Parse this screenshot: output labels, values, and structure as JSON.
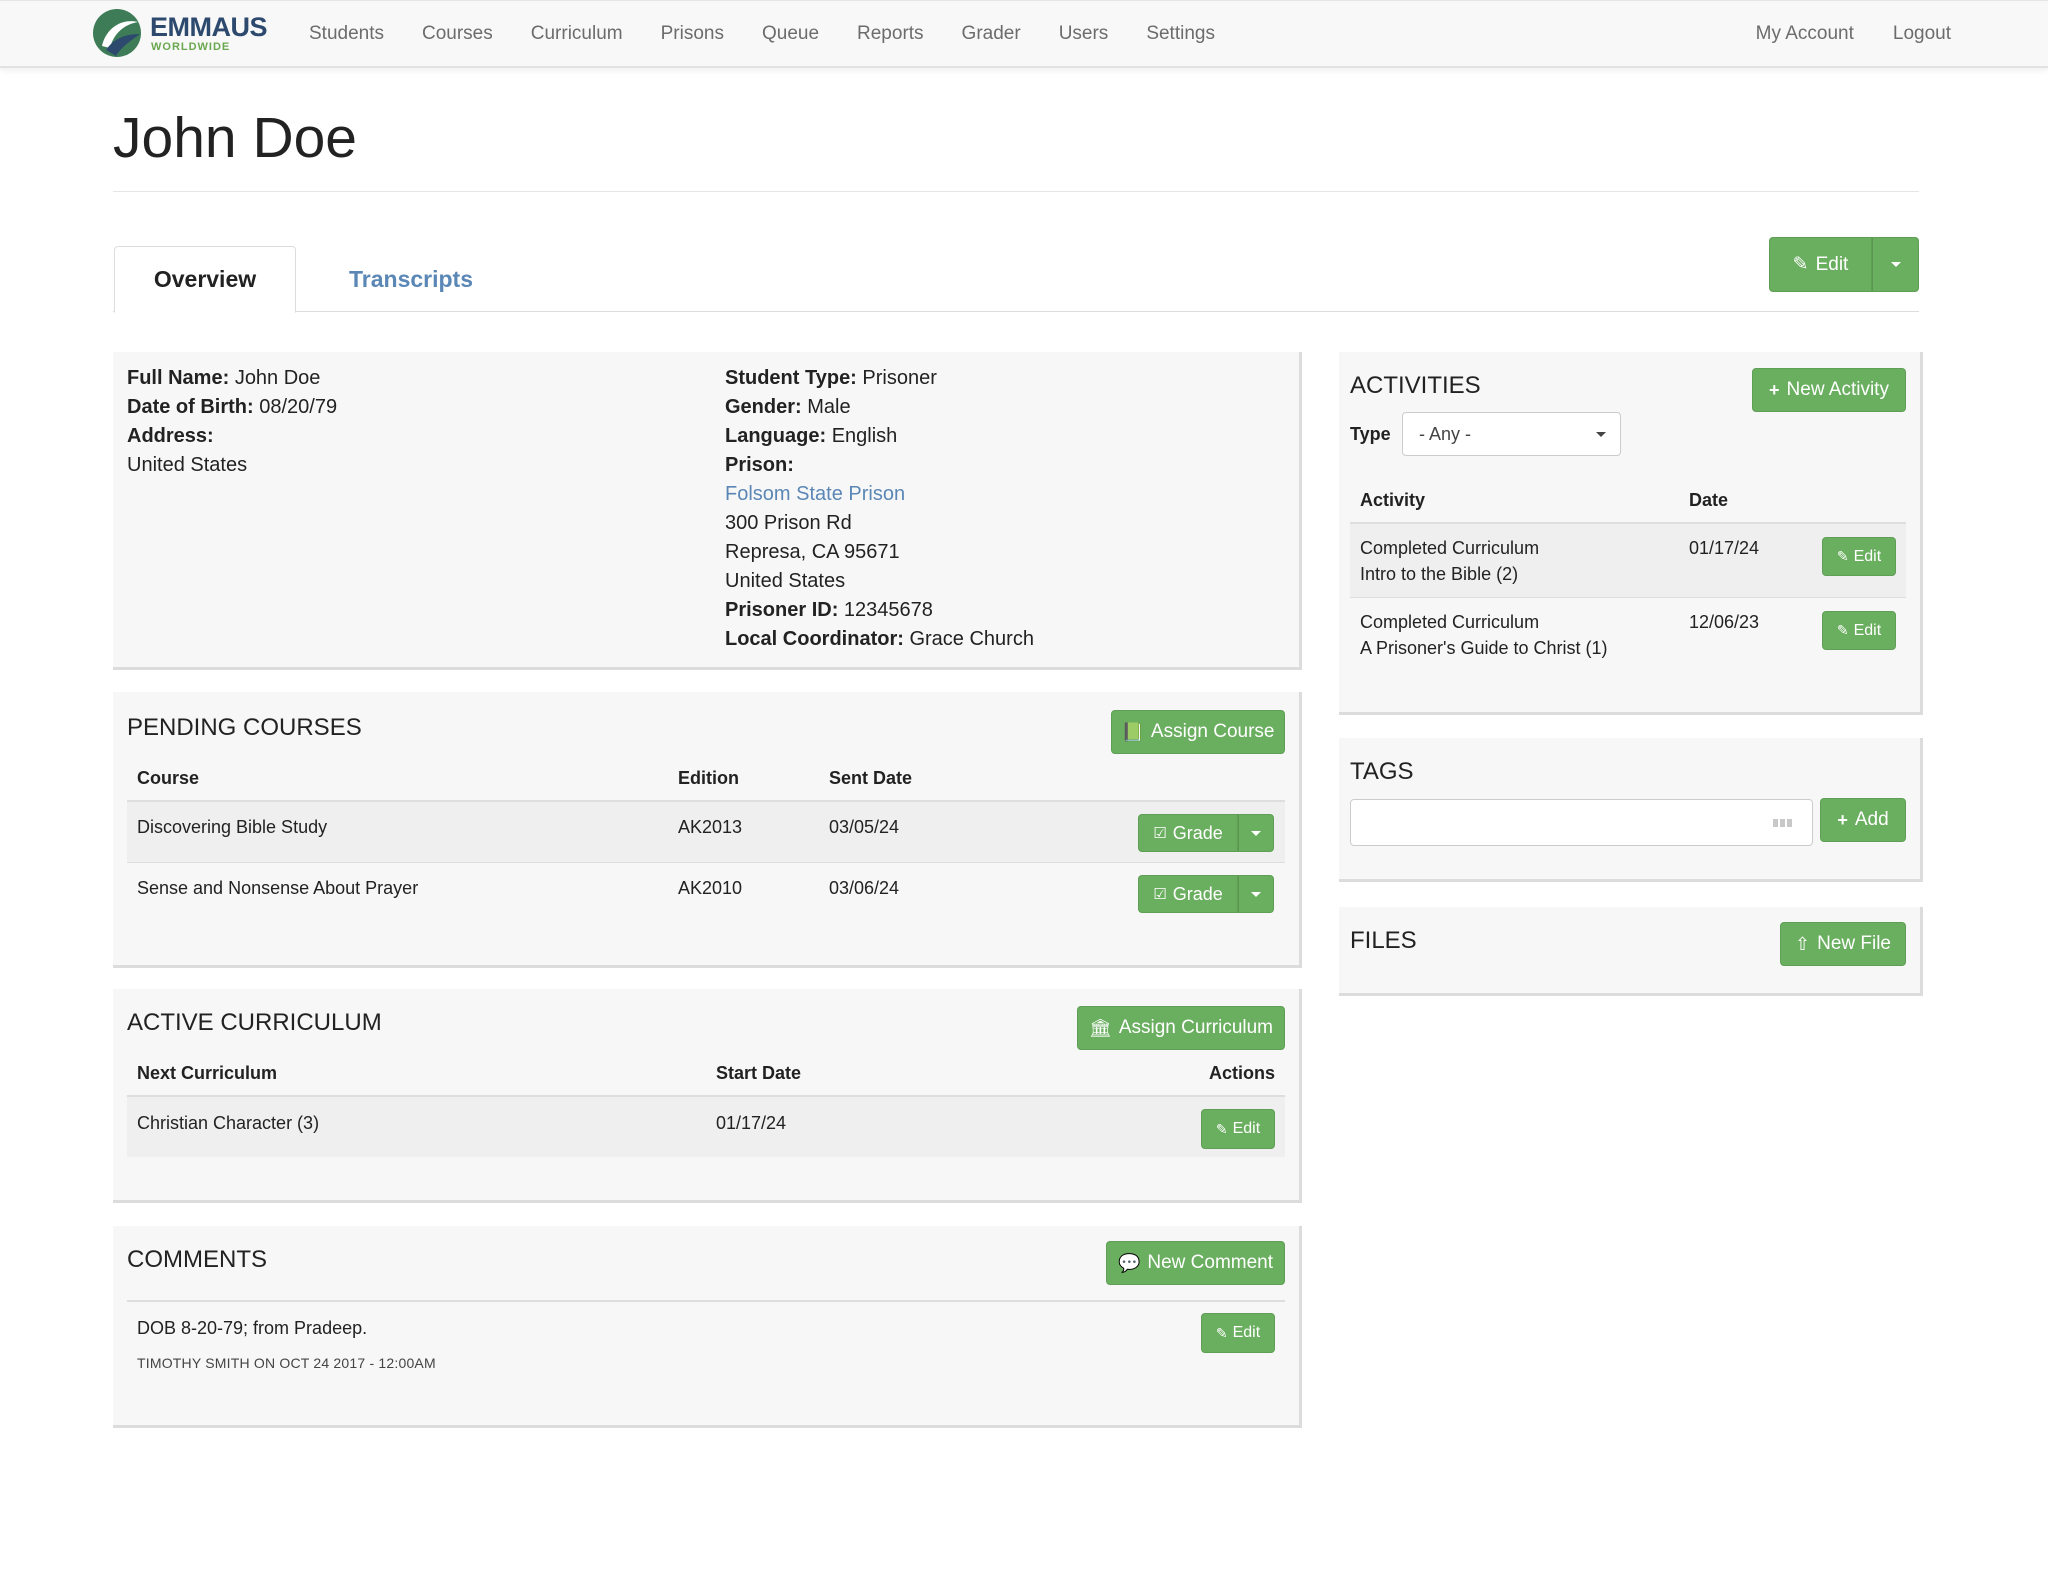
{
  "brand": {
    "name": "EMMAUS",
    "sub": "WORLDWIDE"
  },
  "nav": {
    "left": [
      "Students",
      "Courses",
      "Curriculum",
      "Prisons",
      "Queue",
      "Reports",
      "Grader",
      "Users",
      "Settings"
    ],
    "right": [
      "My Account",
      "Logout"
    ]
  },
  "page": {
    "title": "John Doe"
  },
  "tabs": {
    "overview": "Overview",
    "transcripts": "Transcripts"
  },
  "actions": {
    "edit": "Edit"
  },
  "profile": {
    "full_name_label": "Full Name:",
    "full_name": "John Doe",
    "dob_label": "Date of Birth:",
    "dob": "08/20/79",
    "address_label": "Address:",
    "address_country": "United States",
    "student_type_label": "Student Type:",
    "student_type": "Prisoner",
    "gender_label": "Gender:",
    "gender": "Male",
    "language_label": "Language:",
    "language": "English",
    "prison_label": "Prison:",
    "prison_name": "Folsom State Prison",
    "prison_street": "300 Prison Rd",
    "prison_city": "Represa, CA 95671",
    "prison_country": "United States",
    "prisoner_id_label": "Prisoner ID:",
    "prisoner_id": "12345678",
    "coordinator_label": "Local Coordinator:",
    "coordinator": "Grace Church"
  },
  "pending_courses": {
    "title": "PENDING COURSES",
    "assign_label": "Assign Course",
    "headers": {
      "course": "Course",
      "edition": "Edition",
      "sent_date": "Sent Date"
    },
    "grade_label": "Grade",
    "rows": [
      {
        "course": "Discovering Bible Study",
        "edition": "AK2013",
        "sent_date": "03/05/24"
      },
      {
        "course": "Sense and Nonsense About Prayer",
        "edition": "AK2010",
        "sent_date": "03/06/24"
      }
    ]
  },
  "active_curriculum": {
    "title": "ACTIVE CURRICULUM",
    "assign_label": "Assign Curriculum",
    "headers": {
      "next": "Next Curriculum",
      "start": "Start Date",
      "actions": "Actions"
    },
    "rows": [
      {
        "name": "Christian Character (3)",
        "start": "01/17/24",
        "edit": "Edit"
      }
    ]
  },
  "comments": {
    "title": "COMMENTS",
    "new_label": "New Comment",
    "items": [
      {
        "text": "DOB 8-20-79; from Pradeep.",
        "meta": "TIMOTHY SMITH ON OCT 24 2017 - 12:00AM",
        "edit": "Edit"
      }
    ]
  },
  "activities": {
    "title": "ACTIVITIES",
    "new_label": "New Activity",
    "type_label": "Type",
    "type_value": "- Any -",
    "headers": {
      "activity": "Activity",
      "date": "Date"
    },
    "rows": [
      {
        "line1": "Completed Curriculum",
        "line2": "Intro to the Bible (2)",
        "date": "01/17/24",
        "edit": "Edit"
      },
      {
        "line1": "Completed Curriculum",
        "line2": "A Prisoner's Guide to Christ (1)",
        "date": "12/06/23",
        "edit": "Edit"
      }
    ]
  },
  "tags": {
    "title": "TAGS",
    "add_label": "Add",
    "input_value": ""
  },
  "files": {
    "title": "FILES",
    "new_label": "New File"
  },
  "colors": {
    "accent": "#6aae5f",
    "link": "#5b87b6",
    "brand": "#2d4a6e"
  }
}
